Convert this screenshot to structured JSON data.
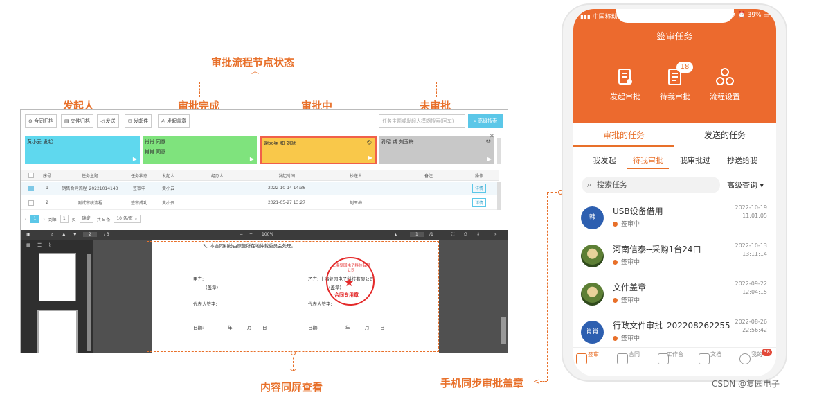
{
  "callouts": {
    "top": "审批流程节点状态",
    "initiator": "发起人",
    "completed": "审批完成",
    "in_progress": "审批中",
    "not_approved": "未审批",
    "bottom": "内容同屏查看",
    "mobile": "手机同步审批盖章"
  },
  "colors": {
    "accent": "#e8702a",
    "phone_header": "#ec6a2e",
    "node_cyan": "#5fd8ee",
    "node_green": "#7fe37d",
    "node_yellow": "#f9c84a",
    "node_gray": "#c8c8c8",
    "primary_btn": "#5bc7e8"
  },
  "desktop": {
    "toolbar": [
      "合同归档",
      "文件归档",
      "发送",
      "发邮件",
      "发起盖章"
    ],
    "search_placeholder": "任务主题或发起人模糊搜索(回车)",
    "advanced_search": "高级搜索",
    "nodes": [
      {
        "text": "黄小云 发起",
        "sub": ""
      },
      {
        "text": "肖肖 同意",
        "sub": "肖肖 同意"
      },
      {
        "text": "谢大兵 和 刘斌",
        "sub": ""
      },
      {
        "text": "孙昭 或 刘玉梅",
        "sub": ""
      }
    ],
    "columns": [
      "序号",
      "任务主题",
      "任务状态",
      "发起人",
      "经办人",
      "发起时间",
      "抄送人",
      "备注",
      "操作"
    ],
    "rows": [
      {
        "no": "1",
        "subject": "销售合同流程_20221014143",
        "status": "签审中",
        "initiator": "黄小云",
        "handler": "",
        "time": "2022-10-14 14:36",
        "cc": "",
        "note": "",
        "op": "详情"
      },
      {
        "no": "2",
        "subject": "测试审核流程",
        "status": "签审成功",
        "initiator": "黄小云",
        "handler": "",
        "time": "2021-05-27 13:27",
        "cc": "刘玉梅",
        "note": "",
        "op": "详情"
      }
    ],
    "pager": {
      "current": "1",
      "goto": "到第",
      "page_input": "1",
      "page_unit": "页",
      "confirm": "确定",
      "total": "共 5 条",
      "per_page": "10 条/页"
    },
    "pdf": {
      "page": "2",
      "total_pages": "/ 3",
      "zoom": "100%",
      "page_right": "1",
      "page_right_total": "/1"
    },
    "doc": {
      "clause": "3、本合同纠纷由原告所在地仲裁委员会处理。",
      "party_a": "甲方:",
      "seal_a": "(盖章)",
      "sign_a": "代表人签字:",
      "date_a": "日期:",
      "party_b": "乙方: 上海复园电子科技有限公司",
      "seal_b": "(盖章)",
      "sign_b": "代表人签字:",
      "date_b": "日期:",
      "year": "年",
      "month": "月",
      "day": "日",
      "stamp_ring": "上海复园电子科技有限公司",
      "stamp_center": "合同专用章"
    }
  },
  "phone": {
    "carrier": "中国移动",
    "battery": "39%",
    "title": "签审任务",
    "actions": [
      {
        "label": "发起审批",
        "icon": "document-sign-icon",
        "badge": ""
      },
      {
        "label": "待我审批",
        "icon": "document-list-icon",
        "badge": "18"
      },
      {
        "label": "流程设置",
        "icon": "flow-icon",
        "badge": ""
      }
    ],
    "tabs": [
      "审批的任务",
      "发送的任务"
    ],
    "subtabs": [
      "我发起",
      "待我审批",
      "我审批过",
      "抄送给我"
    ],
    "search_placeholder": "搜索任务",
    "advanced": "高级查询",
    "tasks": [
      {
        "avatar": "韩",
        "name": "USB设备借用",
        "status": "签审中",
        "date": "2022-10-19",
        "time": "11:01:05",
        "photo": false
      },
      {
        "avatar": "",
        "name": "河南信泰--采购1台24口",
        "status": "签审中",
        "date": "2022-10-13",
        "time": "13:11:14",
        "photo": true
      },
      {
        "avatar": "",
        "name": "文件盖章",
        "status": "签审中",
        "date": "2022-09-22",
        "time": "12:04:15",
        "photo": true
      },
      {
        "avatar": "肖肖",
        "name": "行政文件审批_202208262255",
        "status": "签审中",
        "date": "2022-08-26",
        "time": "22:56:42",
        "photo": false
      }
    ],
    "nav": [
      {
        "label": "签审",
        "badge": ""
      },
      {
        "label": "合同",
        "badge": ""
      },
      {
        "label": "工作台",
        "badge": ""
      },
      {
        "label": "文档",
        "badge": ""
      },
      {
        "label": "我的",
        "badge": "38"
      }
    ]
  },
  "watermark": "CSDN @复园电子"
}
